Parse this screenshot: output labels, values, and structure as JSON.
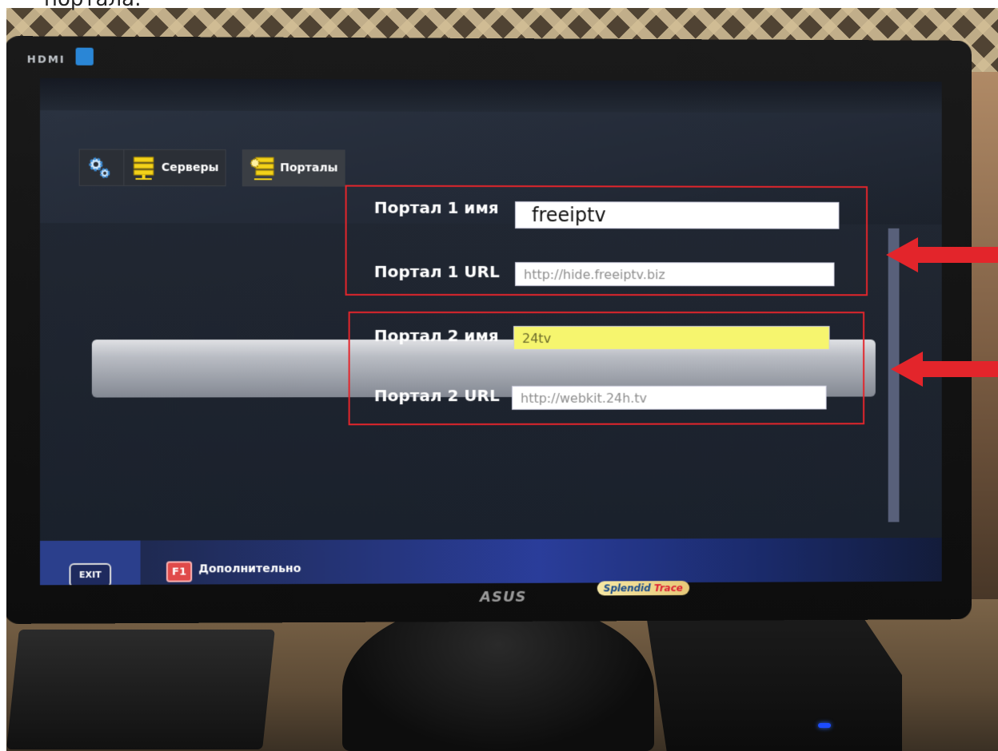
{
  "caption_top": "портала:",
  "monitor": {
    "input_label": "HDMI",
    "brand": "ASUS",
    "sticker": {
      "part1": "Splendid",
      "part2": "Trace"
    }
  },
  "screen": {
    "tabs": [
      {
        "label": ""
      },
      {
        "label": "Серверы"
      },
      {
        "label": "Порталы"
      }
    ],
    "rows": [
      {
        "label": "Портал 1 имя",
        "value": "freeiptv"
      },
      {
        "label": "Портал 1 URL",
        "value": "http://hide.freeiptv.biz"
      },
      {
        "label": "Портал 2 имя",
        "value": "24tv"
      },
      {
        "label": "Портал 2 URL",
        "value": "http://webkit.24h.tv"
      }
    ],
    "bottom": {
      "exit_label": "EXIT",
      "f1_key": "F1",
      "f1_label": "Дополнительно"
    }
  },
  "colors": {
    "highlight_box": "#e3252b",
    "active_field": "#f6f56e",
    "bottom_bar": "#2a3d9a"
  },
  "icons": [
    "gear-icon",
    "server-icon",
    "portal-server-icon",
    "exit-key-icon",
    "arrow-left-icon"
  ]
}
